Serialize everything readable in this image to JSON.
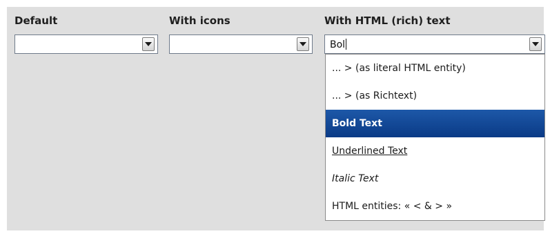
{
  "groups": [
    {
      "label": "Default",
      "value": ""
    },
    {
      "label": "With icons",
      "value": ""
    },
    {
      "label": "With HTML (rich) text",
      "value": "Bol"
    }
  ],
  "dropdown": {
    "items": [
      {
        "label": "... > (as literal HTML entity)",
        "style": "plain",
        "selected": false
      },
      {
        "label": "... > (as Richtext)",
        "style": "plain",
        "selected": false
      },
      {
        "label": "Bold Text",
        "style": "bold",
        "selected": true
      },
      {
        "label": "Underlined Text",
        "style": "underline",
        "selected": false
      },
      {
        "label": "Italic Text",
        "style": "italic",
        "selected": false
      },
      {
        "label": "HTML entities: « < & > »",
        "style": "plain",
        "selected": false
      }
    ]
  },
  "icons": {
    "dropdown_arrow": "chevron-down-icon"
  },
  "colors": {
    "panel_background": "#dfdfdf",
    "selection": "#0a3a86",
    "selection_text": "#ffffff"
  }
}
